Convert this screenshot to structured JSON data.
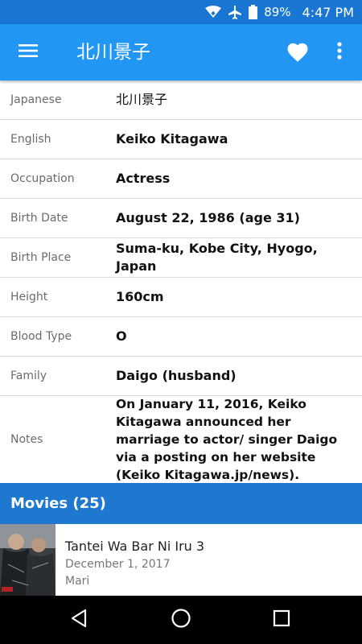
{
  "status_bar": {
    "battery": "89%",
    "time": "4:47 PM",
    "icons": [
      "wifi-icon",
      "airplane-icon",
      "battery-icon"
    ]
  },
  "app_bar": {
    "title": "北川景子",
    "icons": [
      "menu-icon",
      "heart-icon",
      "more-vert-icon"
    ]
  },
  "details": {
    "rows": [
      {
        "label": "Japanese",
        "value": "北川景子"
      },
      {
        "label": "English",
        "value": "Keiko Kitagawa"
      },
      {
        "label": "Occupation",
        "value": "Actress"
      },
      {
        "label": "Birth Date",
        "value": "August 22, 1986 (age 31)"
      },
      {
        "label": "Birth Place",
        "value": "Suma-ku, Kobe City, Hyogo, Japan"
      },
      {
        "label": "Height",
        "value": "160cm"
      },
      {
        "label": "Blood Type",
        "value": "O"
      },
      {
        "label": "Family",
        "value": "Daigo (husband)"
      },
      {
        "label": "Notes",
        "value": "On January 11, 2016, Keiko Kitagawa announced her marriage to actor/ singer Daigo via a posting on her website (Keiko Kitagawa.jp/news)."
      }
    ]
  },
  "movies": {
    "header": "Movies (25)",
    "items": [
      {
        "title": "Tantei Wa Bar Ni Iru 3",
        "date": "December 1, 2017",
        "role": "Mari"
      }
    ]
  },
  "nav_bar": {
    "icons": [
      "back-icon",
      "home-icon",
      "recents-icon"
    ]
  },
  "colors": {
    "status_bar": "#1976d2",
    "app_bar": "#2196f3",
    "section_header": "#1e78d0"
  }
}
